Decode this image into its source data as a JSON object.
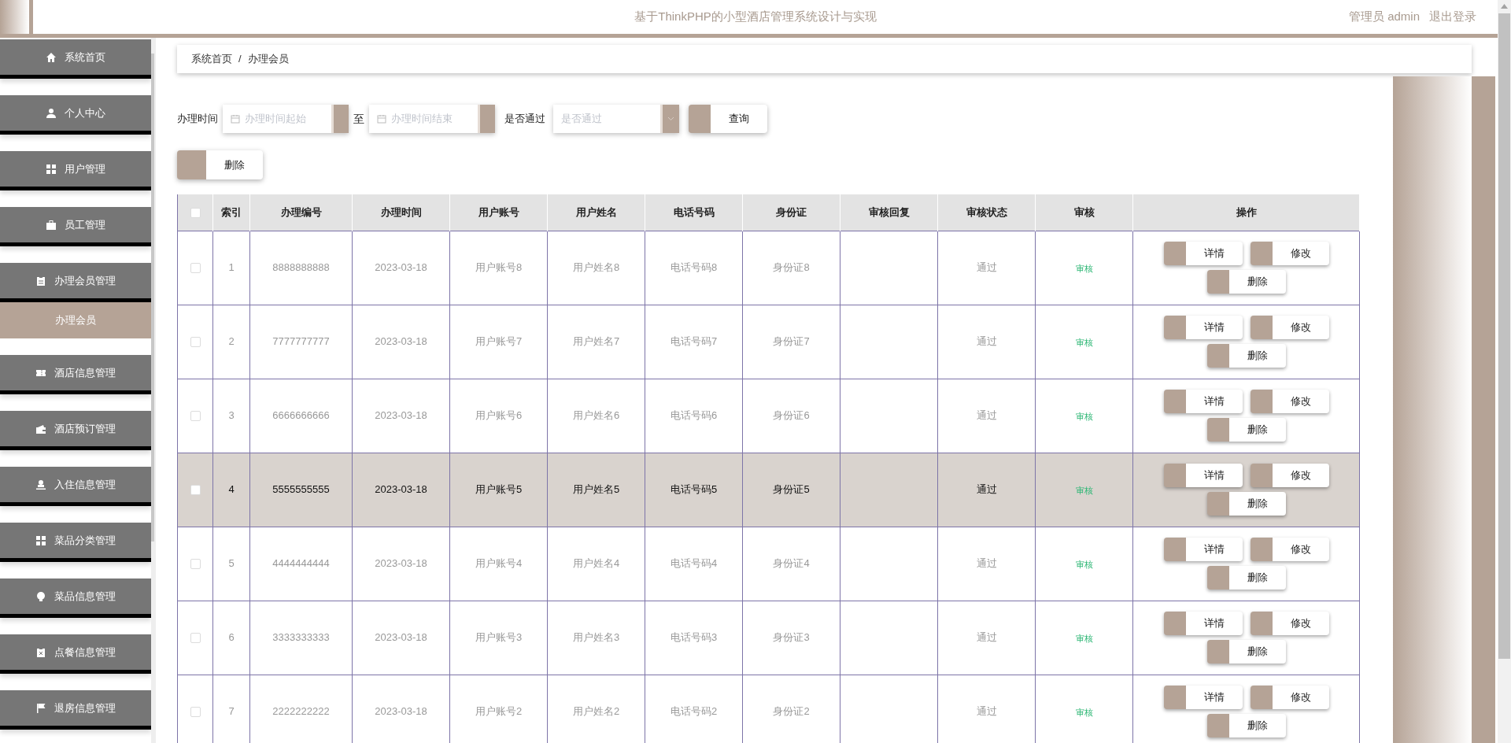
{
  "header": {
    "title": "基于ThinkPHP的小型酒店管理系统设计与实现",
    "user": "管理员 admin",
    "logout": "退出登录"
  },
  "sidebar": {
    "items": [
      {
        "label": "系统首页"
      },
      {
        "label": "个人中心"
      },
      {
        "label": "用户管理"
      },
      {
        "label": "员工管理"
      },
      {
        "label": "办理会员管理",
        "children": [
          {
            "label": "办理会员",
            "selected": true
          }
        ]
      },
      {
        "label": "酒店信息管理"
      },
      {
        "label": "酒店预订管理"
      },
      {
        "label": "入住信息管理"
      },
      {
        "label": "菜品分类管理"
      },
      {
        "label": "菜品信息管理"
      },
      {
        "label": "点餐信息管理"
      },
      {
        "label": "退房信息管理"
      }
    ]
  },
  "breadcrumb": [
    "系统首页",
    "/",
    "办理会员"
  ],
  "filters": {
    "time_label": "办理时间",
    "start_placeholder": "办理时间起始",
    "to": "至",
    "end_placeholder": "办理时间结束",
    "pass_label": "是否通过",
    "pass_placeholder": "是否通过",
    "search_button": "查询"
  },
  "delete_button": "删除",
  "table": {
    "select_all_checked": false,
    "columns": [
      "索引",
      "办理编号",
      "办理时间",
      "用户账号",
      "用户姓名",
      "电话号码",
      "身份证",
      "审核回复",
      "审核状态",
      "审核",
      "操作"
    ],
    "rows": [
      {
        "checked": false,
        "selected": false,
        "cells": [
          "1",
          "8888888888",
          "2023-03-18",
          "用户账号8",
          "用户姓名8",
          "电话号码8",
          "身份证8",
          "",
          "通过"
        ],
        "review": "审核",
        "actions": [
          "详情",
          "修改",
          "删除"
        ]
      },
      {
        "checked": false,
        "selected": false,
        "cells": [
          "2",
          "7777777777",
          "2023-03-18",
          "用户账号7",
          "用户姓名7",
          "电话号码7",
          "身份证7",
          "",
          "通过"
        ],
        "review": "审核",
        "actions": [
          "详情",
          "修改",
          "删除"
        ]
      },
      {
        "checked": false,
        "selected": false,
        "cells": [
          "3",
          "6666666666",
          "2023-03-18",
          "用户账号6",
          "用户姓名6",
          "电话号码6",
          "身份证6",
          "",
          "通过"
        ],
        "review": "审核",
        "actions": [
          "详情",
          "修改",
          "删除"
        ]
      },
      {
        "checked": false,
        "selected": true,
        "cells": [
          "4",
          "5555555555",
          "2023-03-18",
          "用户账号5",
          "用户姓名5",
          "电话号码5",
          "身份证5",
          "",
          "通过"
        ],
        "review": "审核",
        "actions": [
          "详情",
          "修改",
          "删除"
        ]
      },
      {
        "checked": false,
        "selected": false,
        "cells": [
          "5",
          "4444444444",
          "2023-03-18",
          "用户账号4",
          "用户姓名4",
          "电话号码4",
          "身份证4",
          "",
          "通过"
        ],
        "review": "审核",
        "actions": [
          "详情",
          "修改",
          "删除"
        ]
      },
      {
        "checked": false,
        "selected": false,
        "cells": [
          "6",
          "3333333333",
          "2023-03-18",
          "用户账号3",
          "用户姓名3",
          "电话号码3",
          "身份证3",
          "",
          "通过"
        ],
        "review": "审核",
        "actions": [
          "详情",
          "修改",
          "删除"
        ]
      },
      {
        "checked": false,
        "selected": false,
        "cells": [
          "7",
          "2222222222",
          "2023-03-18",
          "用户账号2",
          "用户姓名2",
          "电话号码2",
          "身份证2",
          "",
          "通过"
        ],
        "review": "审核",
        "actions": [
          "详情",
          "修改",
          "删除"
        ]
      }
    ]
  }
}
